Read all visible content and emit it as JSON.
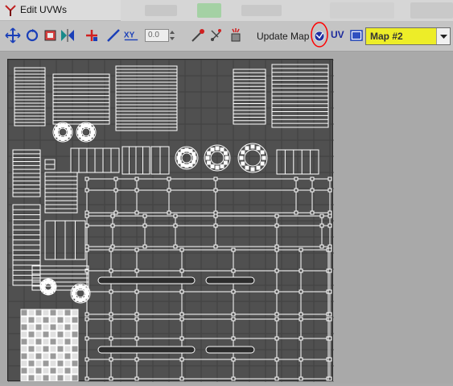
{
  "window": {
    "title": "Edit UVWs",
    "accent_color": "#ff0000"
  },
  "toolbar": {
    "spinner_value": "0.0",
    "update_map_label": "Update Map",
    "uv_label": "UV",
    "map_select": {
      "selected": "Map #2",
      "highlight_color": "#eded28"
    },
    "icons": [
      "move-icon",
      "rotate-icon",
      "scale-icon",
      "mirror-icon",
      "freeform-icon",
      "snap-icon",
      "weld-icon",
      "xy-coords-icon",
      "pick-texture-icon",
      "paint-select-icon",
      "select-element-icon",
      "update-map-icon",
      "show-map-icon"
    ]
  },
  "uv_editor": {
    "background_color": "#505050",
    "island_color": "#ffffff"
  }
}
